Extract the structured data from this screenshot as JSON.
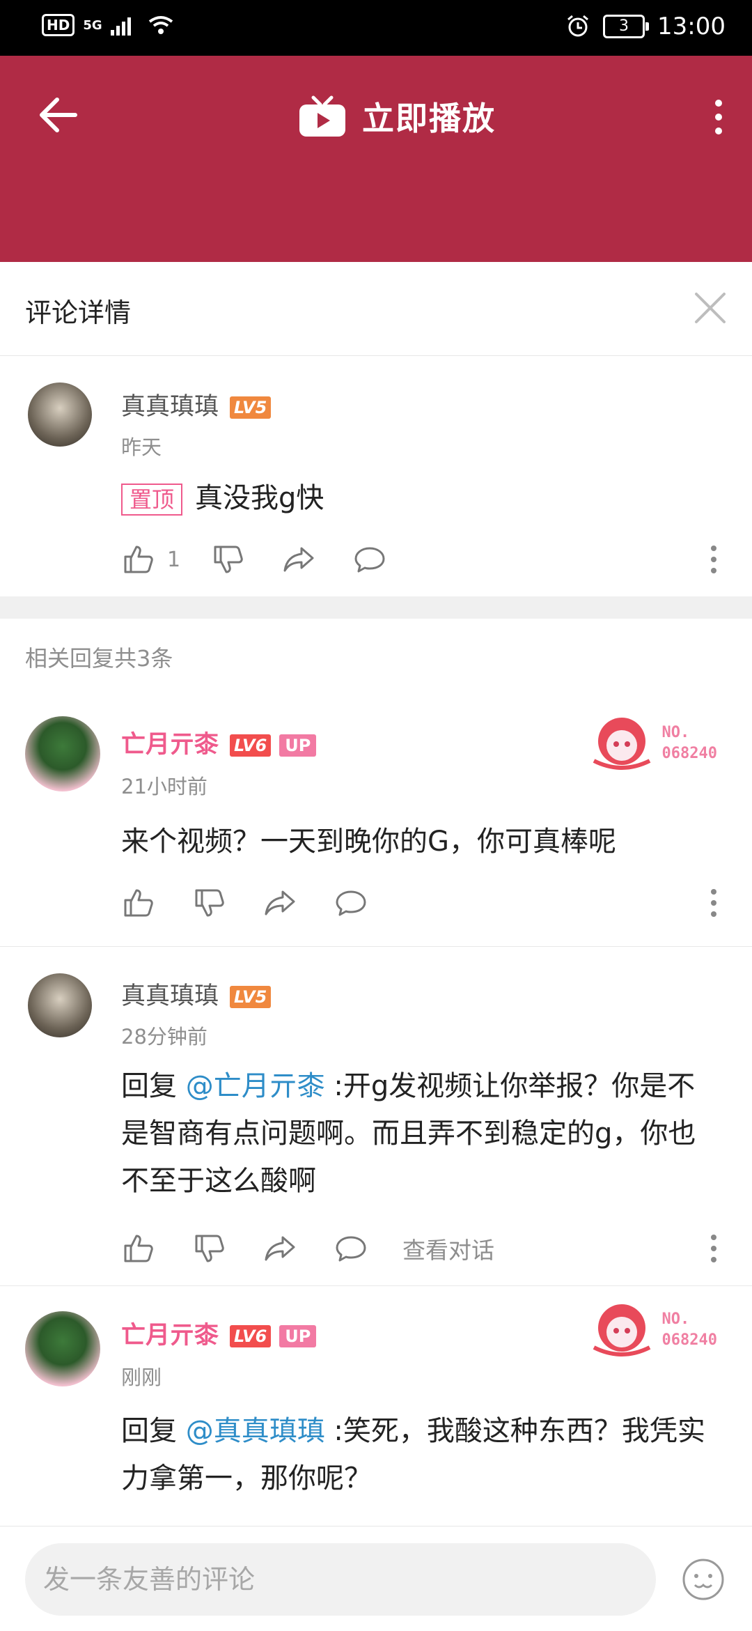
{
  "status_bar": {
    "hd": "HD",
    "net": "5G",
    "battery": "3",
    "time": "13:00"
  },
  "header": {
    "title": "立即播放"
  },
  "detail": {
    "title": "评论详情"
  },
  "main_comment": {
    "user": "真真瑱瑱",
    "level": "LV5",
    "time": "昨天",
    "pin_label": "置顶",
    "text": "真没我g快",
    "like_count": "1"
  },
  "replies_header": "相关回复共3条",
  "replies": [
    {
      "user": "亡月亓桼",
      "level": "LV6",
      "up_label": "UP",
      "badge_no": "NO.",
      "badge_id": "068240",
      "time": "21小时前",
      "text": "来个视频？一天到晚你的G，你可真棒呢"
    },
    {
      "user": "真真瑱瑱",
      "level": "LV5",
      "time": "28分钟前",
      "reply_prefix": "回复",
      "mention": "@亡月亓桼",
      "text": " :开g发视频让你举报？你是不是智商有点问题啊。而且弄不到稳定的g，你也不至于这么酸啊",
      "view_conv": "查看对话"
    },
    {
      "user": "亡月亓桼",
      "level": "LV6",
      "up_label": "UP",
      "badge_no": "NO.",
      "badge_id": "068240",
      "time": "刚刚",
      "reply_prefix": "回复",
      "mention": "@真真瑱瑱",
      "text": " :笑死，我酸这种东西？我凭实力拿第一，那你呢？"
    }
  ],
  "input": {
    "placeholder": "发一条友善的评论"
  },
  "colors": {
    "brand": "#b02b45",
    "pink": "#ef5a8c",
    "mention": "#2e8dc8"
  }
}
